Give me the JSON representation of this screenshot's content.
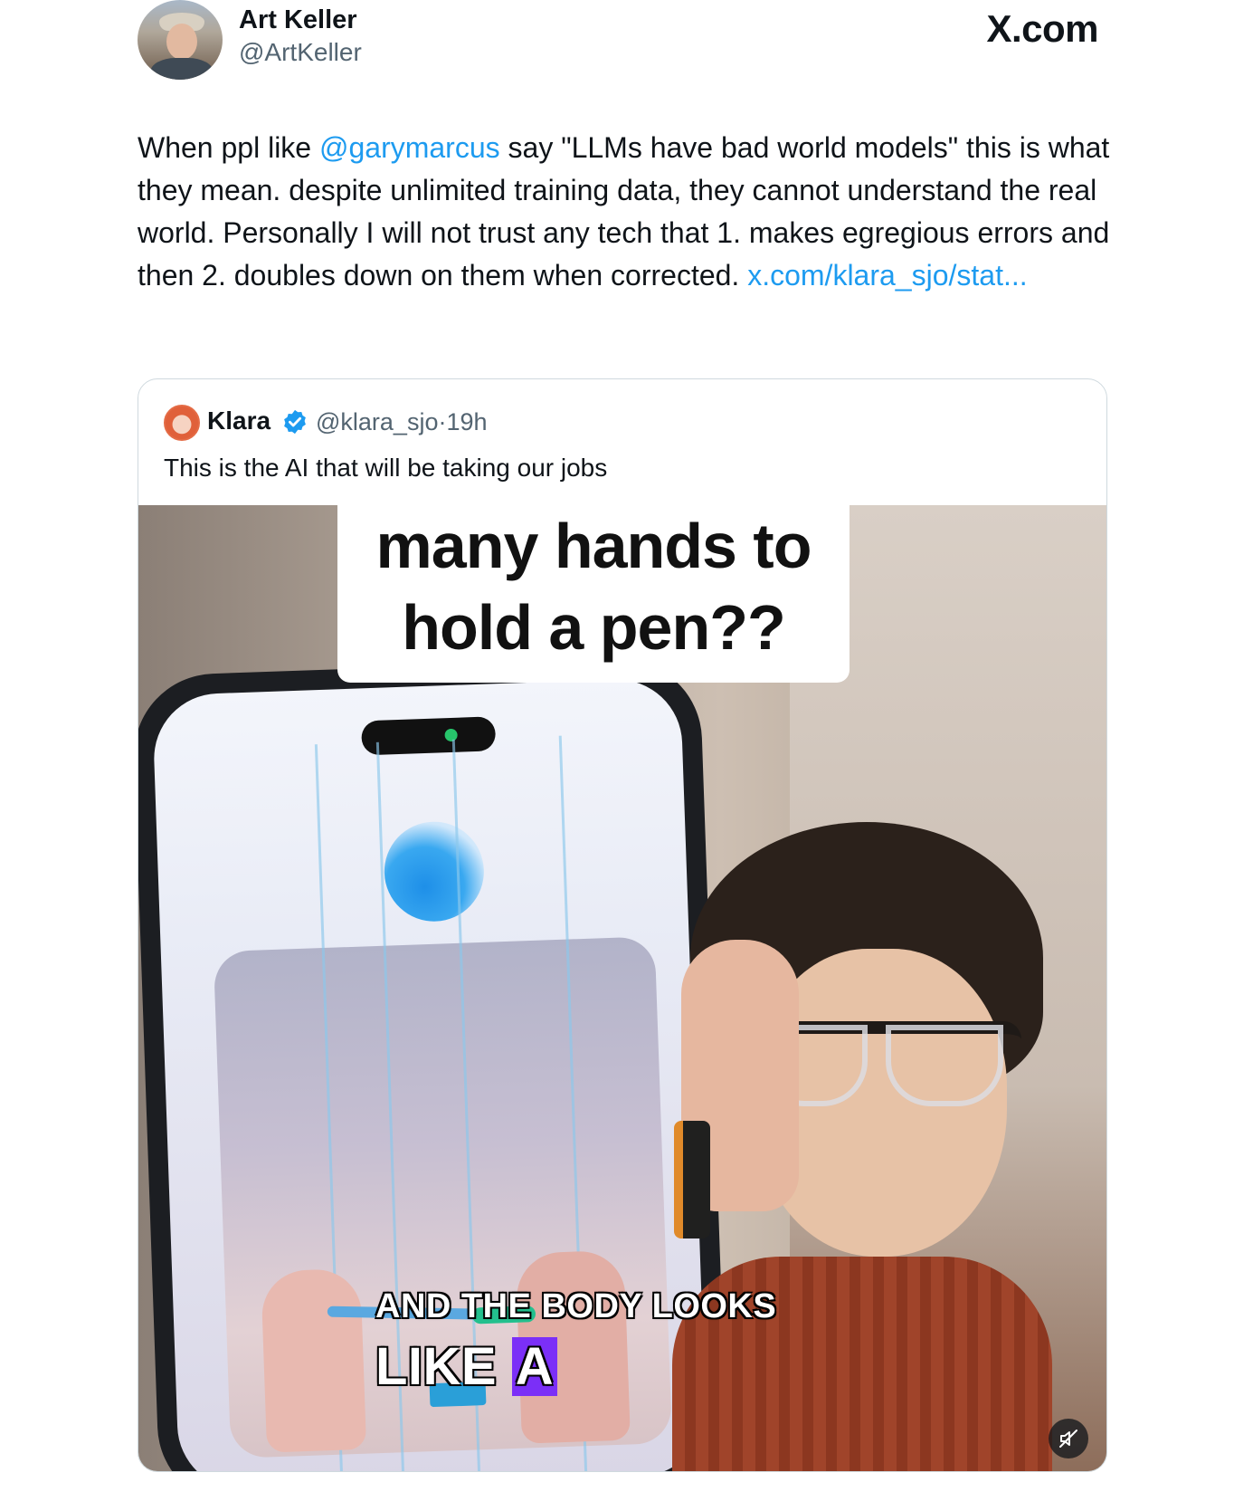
{
  "author": {
    "name": "Art Keller",
    "handle": "@ArtKeller"
  },
  "brand": "X.com",
  "tweet": {
    "text_before_mention": "When ppl like ",
    "mention": "@garymarcus",
    "text_after_mention": " say \"LLMs have bad world models\" this is what they mean. despite unlimited training data, they cannot understand the real world. Personally I will not trust any tech that 1. makes egregious errors and then 2. doubles down on them when corrected. ",
    "link": "x.com/klara_sjo/stat..."
  },
  "quoted": {
    "name": "Klara",
    "handle": "@klara_sjo",
    "separator": "·",
    "time": "19h",
    "text": "This is the AI that will be taking our jobs",
    "verified": true,
    "media": {
      "caption_line_1": "many hands to",
      "caption_line_2": "hold a pen??",
      "subtitle_line_1": "AND THE BODY LOOKS",
      "subtitle_line_2_plain": "LIKE ",
      "subtitle_line_2_highlight": "A",
      "mute_icon": "muted-speaker-icon"
    }
  },
  "colors": {
    "text": "#0f1419",
    "secondary": "#536471",
    "link": "#1d9bf0",
    "border": "#cfd9de",
    "subtitle_highlight": "#7b2ff7"
  }
}
